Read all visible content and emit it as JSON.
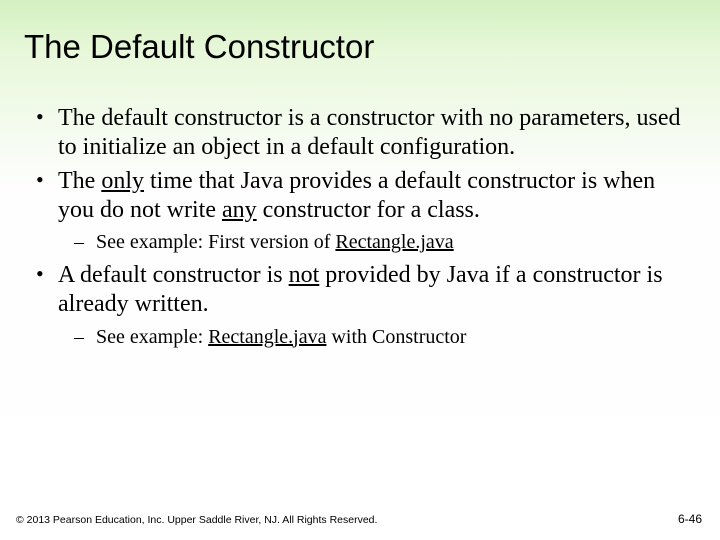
{
  "title": "The Default Constructor",
  "bullets": {
    "b1a": "The default constructor is a constructor with no parameters, used to initialize an object in a default configuration.",
    "b2a": "The ",
    "b2b": "only",
    "b2c": " time that Java provides a default constructor is when you do not write ",
    "b2d": "any",
    "b2e": " constructor for a class.",
    "s2a": "See example:  First version of ",
    "s2b": "Rectangle.java",
    "b3a": "A default constructor is ",
    "b3b": "not",
    "b3c": " provided by Java if a constructor is already written.",
    "s3a": "See example:  ",
    "s3b": "Rectangle.java",
    "s3c": " with Constructor"
  },
  "footer": {
    "copyright": "© 2013 Pearson Education, Inc. Upper Saddle River, NJ. All Rights Reserved.",
    "pagenum": "6-46"
  }
}
